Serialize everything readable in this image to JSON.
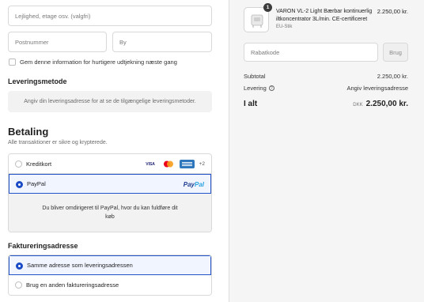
{
  "address": {
    "apartment_placeholder": "Lejlighed, etage osv. (valgfri)",
    "postal_placeholder": "Postnummer",
    "city_placeholder": "By",
    "save_info_label": "Gem denne information for hurtigere udtjekning næste gang"
  },
  "shipping": {
    "heading": "Leveringsmetode",
    "info": "Angiv din leveringsadresse for at se de tilgængelige leveringsmetoder."
  },
  "payment": {
    "heading": "Betaling",
    "subheading": "Alle transaktioner er sikre og krypterede.",
    "credit_card_label": "Kreditkort",
    "card_badges": [
      "VISA",
      "Mastercard",
      "AMEX"
    ],
    "more_cards": "+2",
    "paypal_label": "PayPal",
    "paypal_logo_pay": "Pay",
    "paypal_logo_pal": "Pal",
    "paypal_info": "Du bliver omdirigeret til PayPal, hvor du kan fuldføre dit køb",
    "selected": "PayPal"
  },
  "billing": {
    "heading": "Faktureringsadresse",
    "same_label": "Samme adresse som leveringsadressen",
    "different_label": "Brug en anden faktureringsadresse",
    "selected": "same"
  },
  "summary": {
    "product_name": "VARON VL-2 Light Bærbar kontinuerlig iltkoncentrator 3L/min. CE-certificeret",
    "product_variant": "EU-Stik",
    "product_price": "2.250,00 kr.",
    "quantity": "1",
    "discount_placeholder": "Rabatkode",
    "apply_label": "Brug",
    "subtotal_label": "Subtotal",
    "subtotal_value": "2.250,00 kr.",
    "shipping_label": "Levering",
    "shipping_value": "Angiv leveringsadresse",
    "total_label": "I alt",
    "currency": "DKK",
    "total_value": "2.250,00 kr."
  },
  "colors": {
    "accent": "#1a4ac6",
    "selected_bg": "#f1f5ff",
    "summary_bg": "#f5f5f5"
  }
}
